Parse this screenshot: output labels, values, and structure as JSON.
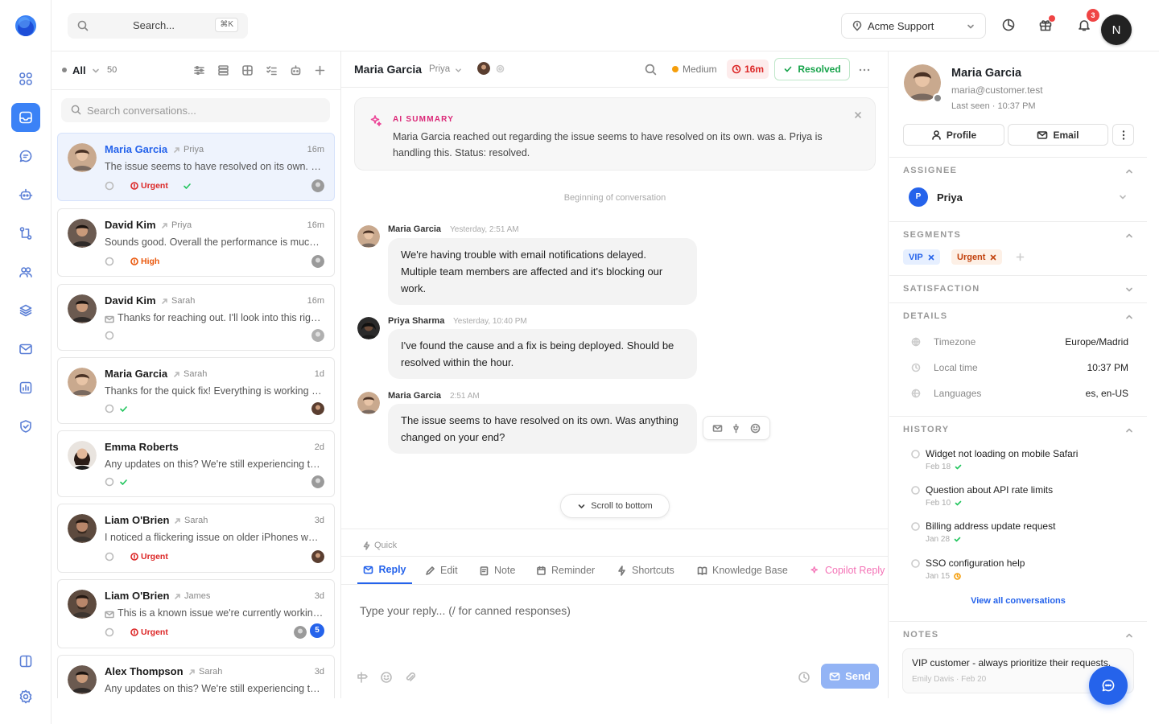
{
  "header": {
    "search_placeholder": "Search...",
    "search_shortcut": "⌘K",
    "workspace": "Acme Support",
    "notification_count": "3",
    "user_initial": "N"
  },
  "rail": {
    "items": [
      "dashboard",
      "inbox",
      "chat",
      "bots",
      "workflows",
      "contacts",
      "knowledge",
      "campaigns",
      "reports",
      "security",
      "panels",
      "settings"
    ]
  },
  "list": {
    "filter": "All",
    "count": "50",
    "search_placeholder": "Search conversations...",
    "conversations": [
      {
        "name": "Maria Garcia",
        "assignee": "Priya",
        "time": "16m",
        "preview": "The issue seems to have resolved on its own. Was anything changed on your end?",
        "priority": "Urgent",
        "resolved": true
      },
      {
        "name": "David Kim",
        "assignee": "Priya",
        "time": "16m",
        "preview": "Sounds good. Overall the performance is much better now, thanks!",
        "priority": "High",
        "resolved": false
      },
      {
        "name": "David Kim",
        "assignee": "Sarah",
        "time": "16m",
        "preview": "Thanks for reaching out. I'll look into this right away.",
        "priority": "",
        "resolved": false
      },
      {
        "name": "Maria Garcia",
        "assignee": "Sarah",
        "time": "1d",
        "preview": "Thanks for the quick fix! Everything is working perfectly now.",
        "priority": "",
        "resolved": true
      },
      {
        "name": "Emma Roberts",
        "assignee": "",
        "time": "2d",
        "preview": "Any updates on this? We're still experiencing the same problem.",
        "priority": "",
        "resolved": true
      },
      {
        "name": "Liam O'Brien",
        "assignee": "Sarah",
        "time": "3d",
        "preview": "I noticed a flickering issue on older iPhones when scrolling.",
        "priority": "Urgent",
        "resolved": false
      },
      {
        "name": "Liam O'Brien",
        "assignee": "James",
        "time": "3d",
        "preview": "This is a known issue we're currently working on a fix for.",
        "priority": "Urgent",
        "resolved": false,
        "unread": "5"
      },
      {
        "name": "Alex Thompson",
        "assignee": "Sarah",
        "time": "3d",
        "preview": "Any updates on this? We're still experiencing the same problem.",
        "priority": "",
        "resolved": false
      }
    ]
  },
  "conversation": {
    "contact": "Maria Garcia",
    "assignee": "Priya",
    "priority": "Medium",
    "sla": "16m",
    "status": "Resolved",
    "ai_summary": {
      "label": "AI SUMMARY",
      "text": "Maria Garcia reached out regarding the issue seems to have resolved on its own. was a. Priya is handling this. Status: resolved."
    },
    "beginning": "Beginning of conversation",
    "messages": [
      {
        "author": "Maria Garcia",
        "time": "Yesterday, 2:51 AM",
        "text": "We're having trouble with email notifications delayed. Multiple team members are affected and it's blocking our work."
      },
      {
        "author": "Priya Sharma",
        "time": "Yesterday, 10:40 PM",
        "text": "I've found the cause and a fix is being deployed. Should be resolved within the hour."
      },
      {
        "author": "Maria Garcia",
        "time": "2:51 AM",
        "text": "The issue seems to have resolved on its own. Was anything changed on your end?"
      }
    ],
    "scroll_to_bottom": "Scroll to bottom"
  },
  "composer": {
    "quick": "Quick",
    "tabs": [
      "Reply",
      "Edit",
      "Note",
      "Reminder",
      "Shortcuts",
      "Knowledge Base",
      "Copilot Reply"
    ],
    "placeholder": "Type your reply... (/ for canned responses)",
    "send": "Send"
  },
  "profile": {
    "name": "Maria Garcia",
    "email": "maria@customer.test",
    "last_seen_label": "Last seen ·",
    "last_seen": "10:37 PM",
    "profile_btn": "Profile",
    "email_btn": "Email",
    "sections": {
      "assignee": "ASSIGNEE",
      "segments": "SEGMENTS",
      "satisfaction": "SATISFACTION",
      "details": "DETAILS",
      "history": "HISTORY",
      "notes": "NOTES"
    },
    "assignee": {
      "initial": "P",
      "name": "Priya"
    },
    "segments": [
      "VIP",
      "Urgent"
    ],
    "details": [
      {
        "key": "Timezone",
        "value": "Europe/Madrid"
      },
      {
        "key": "Local time",
        "value": "10:37 PM"
      },
      {
        "key": "Languages",
        "value": "es, en-US"
      }
    ],
    "history": [
      {
        "title": "Widget not loading on mobile Safari",
        "date": "Feb 18",
        "status": "resolved"
      },
      {
        "title": "Question about API rate limits",
        "date": "Feb 10",
        "status": "resolved"
      },
      {
        "title": "Billing address update request",
        "date": "Jan 28",
        "status": "resolved"
      },
      {
        "title": "SSO configuration help",
        "date": "Jan 15",
        "status": "pending"
      }
    ],
    "view_all": "View all conversations",
    "note": {
      "text": "VIP customer - always prioritize their requests.",
      "meta": "Emily Davis · Feb 20"
    }
  },
  "colors": {
    "accent": "#2563eb",
    "urgent": "#dc2626",
    "high": "#ea580c",
    "resolved": "#16a34a",
    "copilot": "#f472b6"
  }
}
